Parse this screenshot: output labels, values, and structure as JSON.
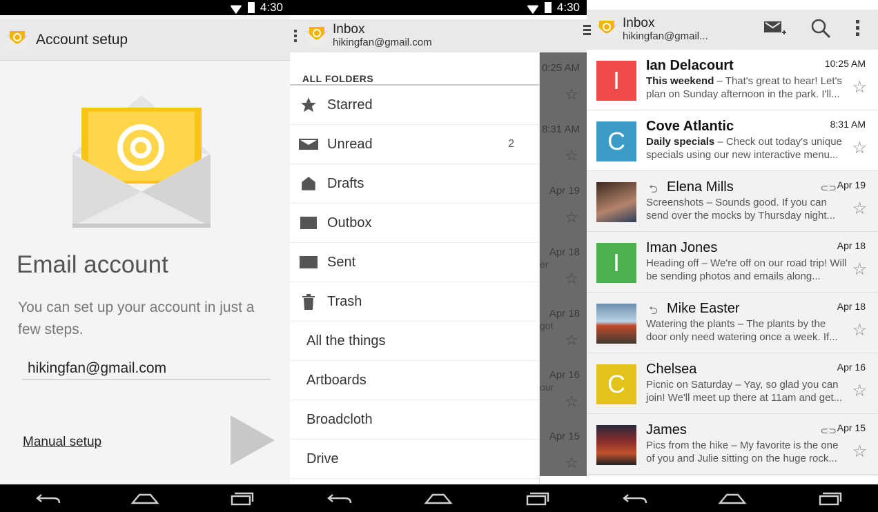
{
  "statusbar": {
    "time": "4:30"
  },
  "panel1": {
    "title": "Account setup",
    "heading": "Email account",
    "description": "You can set up your account in just a few steps.",
    "email_value": "hikingfan@gmail.com",
    "manual_setup": "Manual setup"
  },
  "panel2": {
    "title": "Inbox",
    "account": "hikingfan@gmail.com",
    "folders_header": "ALL FOLDERS",
    "folders": [
      {
        "label": "Starred",
        "icon": "star-icon",
        "count": ""
      },
      {
        "label": "Unread",
        "icon": "unread-icon",
        "count": "2"
      },
      {
        "label": "Drafts",
        "icon": "drafts-icon",
        "count": ""
      },
      {
        "label": "Outbox",
        "icon": "outbox-icon",
        "count": ""
      },
      {
        "label": "Sent",
        "icon": "sent-icon",
        "count": ""
      },
      {
        "label": "Trash",
        "icon": "trash-icon",
        "count": ""
      },
      {
        "label": "All the things",
        "icon": "",
        "count": ""
      },
      {
        "label": "Artboards",
        "icon": "",
        "count": ""
      },
      {
        "label": "Broadcloth",
        "icon": "",
        "count": ""
      },
      {
        "label": "Drive",
        "icon": "",
        "count": ""
      }
    ],
    "behind": [
      {
        "date": "0:25 AM",
        "extra": ""
      },
      {
        "date": "8:31 AM",
        "extra": ""
      },
      {
        "date": "Apr 19",
        "extra": ""
      },
      {
        "date": "Apr 18",
        "extra": "er"
      },
      {
        "date": "Apr 18",
        "extra": "got"
      },
      {
        "date": "Apr 16",
        "extra": "our"
      },
      {
        "date": "Apr 15",
        "extra": ""
      }
    ]
  },
  "panel3": {
    "title": "Inbox",
    "account": "hikingfan@gmail...",
    "mails": [
      {
        "sender": "Ian Delacourt",
        "date": "10:25 AM",
        "subject": "This weekend",
        "snippet": " – That's great to hear! Let's plan on Sunday afternoon in the park. I'll...",
        "avatar_letter": "I",
        "avatar_color": "#ef4b4b",
        "unread": true,
        "reply": false,
        "clip": false,
        "photo": false
      },
      {
        "sender": "Cove Atlantic",
        "date": "8:31 AM",
        "subject": "Daily specials",
        "snippet": " – Check out today's unique specials using our new interactive menu...",
        "avatar_letter": "C",
        "avatar_color": "#3a9bc6",
        "unread": true,
        "reply": false,
        "clip": false,
        "photo": false
      },
      {
        "sender": "Elena Mills",
        "date": "Apr 19",
        "subject": "Screenshots",
        "snippet": " – Sounds good. If you can send over the mocks by Thursday night...",
        "avatar_letter": "",
        "avatar_color": "#6b5242",
        "unread": false,
        "reply": true,
        "clip": true,
        "photo": true
      },
      {
        "sender": "Iman Jones",
        "date": "Apr 18",
        "subject": "Heading off",
        "snippet": " – We're off on our road trip! Will be sending photos and emails along...",
        "avatar_letter": "I",
        "avatar_color": "#4caf50",
        "unread": false,
        "reply": false,
        "clip": false,
        "photo": false
      },
      {
        "sender": "Mike Easter",
        "date": "Apr 18",
        "subject": "Watering the plants",
        "snippet": " – The plants by the door only need watering once a week. If...",
        "avatar_letter": "",
        "avatar_color": "#6d8fae",
        "unread": false,
        "reply": true,
        "clip": false,
        "photo": true
      },
      {
        "sender": "Chelsea",
        "date": "Apr 16",
        "subject": "Picnic on Saturday",
        "snippet": " – Yay, so glad you can join! We'll meet up there at 11am and get...",
        "avatar_letter": "C",
        "avatar_color": "#e3c31a",
        "unread": false,
        "reply": false,
        "clip": false,
        "photo": false
      },
      {
        "sender": "James",
        "date": "Apr 15",
        "subject": "Pics from the hike",
        "snippet": " – My favorite is the one of you and Julie sitting on the huge rock...",
        "avatar_letter": "",
        "avatar_color": "#8a2c2c",
        "unread": false,
        "reply": false,
        "clip": true,
        "photo": true
      }
    ]
  }
}
